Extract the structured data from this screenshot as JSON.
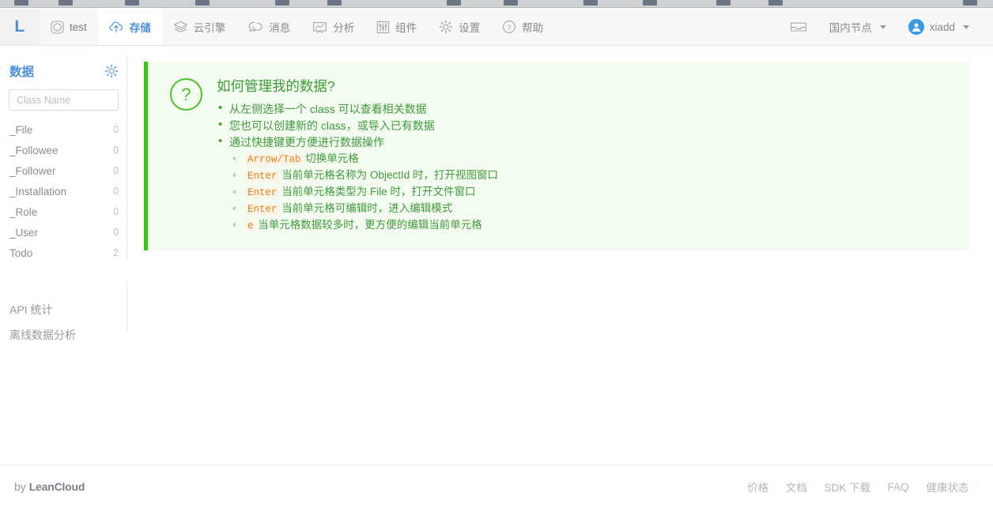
{
  "topnav": {
    "logo": "L",
    "items": [
      {
        "label": "test",
        "icon": "app-square-icon",
        "name": "nav-app-test",
        "active": false
      },
      {
        "label": "存储",
        "icon": "cloud-upload-icon",
        "name": "nav-storage",
        "active": true
      },
      {
        "label": "云引擎",
        "icon": "layers-icon",
        "name": "nav-cloud-engine",
        "active": false
      },
      {
        "label": "消息",
        "icon": "chat-bubbles-icon",
        "name": "nav-messaging",
        "active": false
      },
      {
        "label": "分析",
        "icon": "chart-board-icon",
        "name": "nav-analytics",
        "active": false
      },
      {
        "label": "组件",
        "icon": "sliders-icon",
        "name": "nav-components",
        "active": false
      },
      {
        "label": "设置",
        "icon": "gear-icon",
        "name": "nav-settings",
        "active": false
      },
      {
        "label": "帮助",
        "icon": "question-circle-icon",
        "name": "nav-help",
        "active": false
      }
    ],
    "inbox_icon": "inbox-icon",
    "region_label": "国内节点",
    "user_label": "xiadd"
  },
  "sidebar": {
    "title": "数据",
    "gear_icon": "gear-icon",
    "search": {
      "placeholder": "Class Name",
      "value": ""
    },
    "classes": [
      {
        "name": "_File",
        "count": "0"
      },
      {
        "name": "_Followee",
        "count": "0"
      },
      {
        "name": "_Follower",
        "count": "0"
      },
      {
        "name": "_Installation",
        "count": "0"
      },
      {
        "name": "_Role",
        "count": "0"
      },
      {
        "name": "_User",
        "count": "0"
      },
      {
        "name": "Todo",
        "count": "2"
      }
    ],
    "links": [
      {
        "label": "API 统计"
      },
      {
        "label": "离线数据分析"
      }
    ]
  },
  "help": {
    "icon": "question-mark-icon",
    "title": "如何管理我的数据?",
    "bullets": [
      {
        "text": "从左侧选择一个 class 可以查看相关数据"
      },
      {
        "text": "您也可以创建新的 class，或导入已有数据"
      },
      {
        "text": "通过快捷键更方便进行数据操作"
      }
    ],
    "shortcuts": [
      {
        "key": "Arrow/Tab",
        "text": "切换单元格"
      },
      {
        "key": "Enter",
        "text": "当前单元格名称为 ObjectId 时，打开视图窗口"
      },
      {
        "key": "Enter",
        "text": "当前单元格类型为 File 时，打开文件窗口"
      },
      {
        "key": "Enter",
        "text": "当前单元格可编辑时，进入编辑模式"
      },
      {
        "key": "e",
        "text": "当单元格数据较多时，更方便的编辑当前单元格"
      }
    ]
  },
  "footer": {
    "brand_prefix": "by ",
    "brand_name": "LeanCloud",
    "links": [
      {
        "label": "价格"
      },
      {
        "label": "文档"
      },
      {
        "label": "SDK 下载"
      },
      {
        "label": "FAQ"
      },
      {
        "label": "健康状态"
      }
    ],
    "separator": "·"
  },
  "colors": {
    "accent_blue": "#4a90d9",
    "help_green": "#3f9a3a",
    "help_border": "#2ecc0f",
    "help_bg": "#f4fcf2",
    "key_orange": "#e08420"
  }
}
